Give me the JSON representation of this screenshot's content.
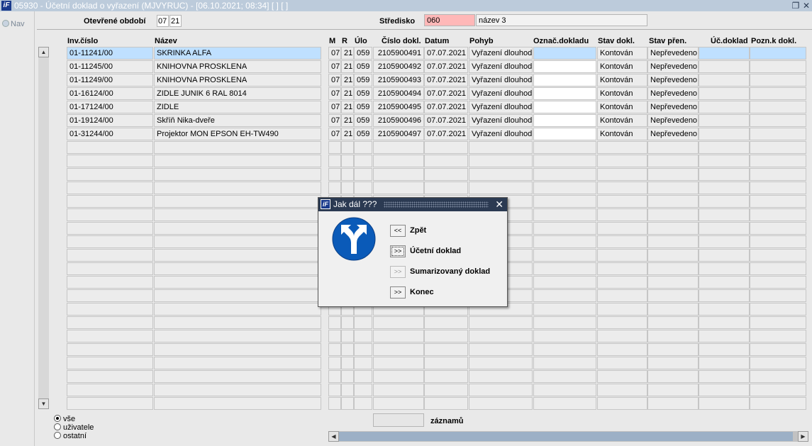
{
  "window": {
    "title": "05930 - Účetní doklad o vyřazení (MJVYRUC) - [06.10.2021; 08:34]  [ ]  [ ]",
    "logo": "iF"
  },
  "nav": {
    "label": "Nav"
  },
  "header": {
    "period_label": "Otevřené období",
    "period_month": "07",
    "period_year": "21",
    "center_label": "Středisko",
    "center_code": "060",
    "center_name": "název 3"
  },
  "columns": {
    "inv": "Inv.číslo",
    "name": "Název",
    "m": "M",
    "r": "R",
    "ulo": "Úlo",
    "doc": "Číslo dokl.",
    "date": "Datum",
    "move": "Pohyb",
    "mark": "Označ.dokladu",
    "state": "Stav dokl.",
    "transfer": "Stav přen.",
    "acc_doc": "Úč.doklad",
    "note": "Pozn.k dokl."
  },
  "rows": [
    {
      "inv": "01-11241/00",
      "name": "SKRINKA ALFA",
      "m": "07",
      "r": "21",
      "ulo": "059",
      "doc": "2105900491",
      "date": "07.07.2021",
      "move": "Vyřazení dlouhod",
      "mark": "",
      "state": "Kontován",
      "transfer": "Nepřevedeno",
      "acc_doc": "",
      "note": ""
    },
    {
      "inv": "01-11245/00",
      "name": "KNIHOVNA PROSKLENA",
      "m": "07",
      "r": "21",
      "ulo": "059",
      "doc": "2105900492",
      "date": "07.07.2021",
      "move": "Vyřazení dlouhod",
      "mark": "",
      "state": "Kontován",
      "transfer": "Nepřevedeno",
      "acc_doc": "",
      "note": ""
    },
    {
      "inv": "01-11249/00",
      "name": "KNIHOVNA PROSKLENA",
      "m": "07",
      "r": "21",
      "ulo": "059",
      "doc": "2105900493",
      "date": "07.07.2021",
      "move": "Vyřazení dlouhod",
      "mark": "",
      "state": "Kontován",
      "transfer": "Nepřevedeno",
      "acc_doc": "",
      "note": ""
    },
    {
      "inv": "01-16124/00",
      "name": "ZIDLE JUNIK 6 RAL 8014",
      "m": "07",
      "r": "21",
      "ulo": "059",
      "doc": "2105900494",
      "date": "07.07.2021",
      "move": "Vyřazení dlouhod",
      "mark": "",
      "state": "Kontován",
      "transfer": "Nepřevedeno",
      "acc_doc": "",
      "note": ""
    },
    {
      "inv": "01-17124/00",
      "name": "ZIDLE",
      "m": "07",
      "r": "21",
      "ulo": "059",
      "doc": "2105900495",
      "date": "07.07.2021",
      "move": "Vyřazení dlouhod",
      "mark": "",
      "state": "Kontován",
      "transfer": "Nepřevedeno",
      "acc_doc": "",
      "note": ""
    },
    {
      "inv": "01-19124/00",
      "name": "Skříň Nika-dveře",
      "m": "07",
      "r": "21",
      "ulo": "059",
      "doc": "2105900496",
      "date": "07.07.2021",
      "move": "Vyřazení dlouhod",
      "mark": "",
      "state": "Kontován",
      "transfer": "Nepřevedeno",
      "acc_doc": "",
      "note": ""
    },
    {
      "inv": "01-31244/00",
      "name": "Projektor MON EPSON EH-TW490",
      "m": "07",
      "r": "21",
      "ulo": "059",
      "doc": "2105900497",
      "date": "07.07.2021",
      "move": "Vyřazení dlouhod",
      "mark": "",
      "state": "Kontován",
      "transfer": "Nepřevedeno",
      "acc_doc": "",
      "note": ""
    }
  ],
  "empty_rows": 20,
  "filter": {
    "all": "vše",
    "users": "uživatele",
    "others": "ostatní"
  },
  "footer": {
    "records_label": "záznamů",
    "records_value": ""
  },
  "dialog": {
    "title": "Jak dál ???",
    "back_btn": "<<",
    "back_label": "Zpět",
    "acc_btn": ">>",
    "acc_label": "Účetní doklad",
    "sum_btn": ">>",
    "sum_label": "Sumarizovaný doklad",
    "end_btn": ">>",
    "end_label": "Konec"
  },
  "colors": {
    "selected_row": "#bfe0ff",
    "center_code_bg": "#ffb8b8",
    "title_bg": "#bccbdb",
    "dialog_title_bg": "#2b3a52",
    "sign_blue": "#0a5ab8"
  }
}
